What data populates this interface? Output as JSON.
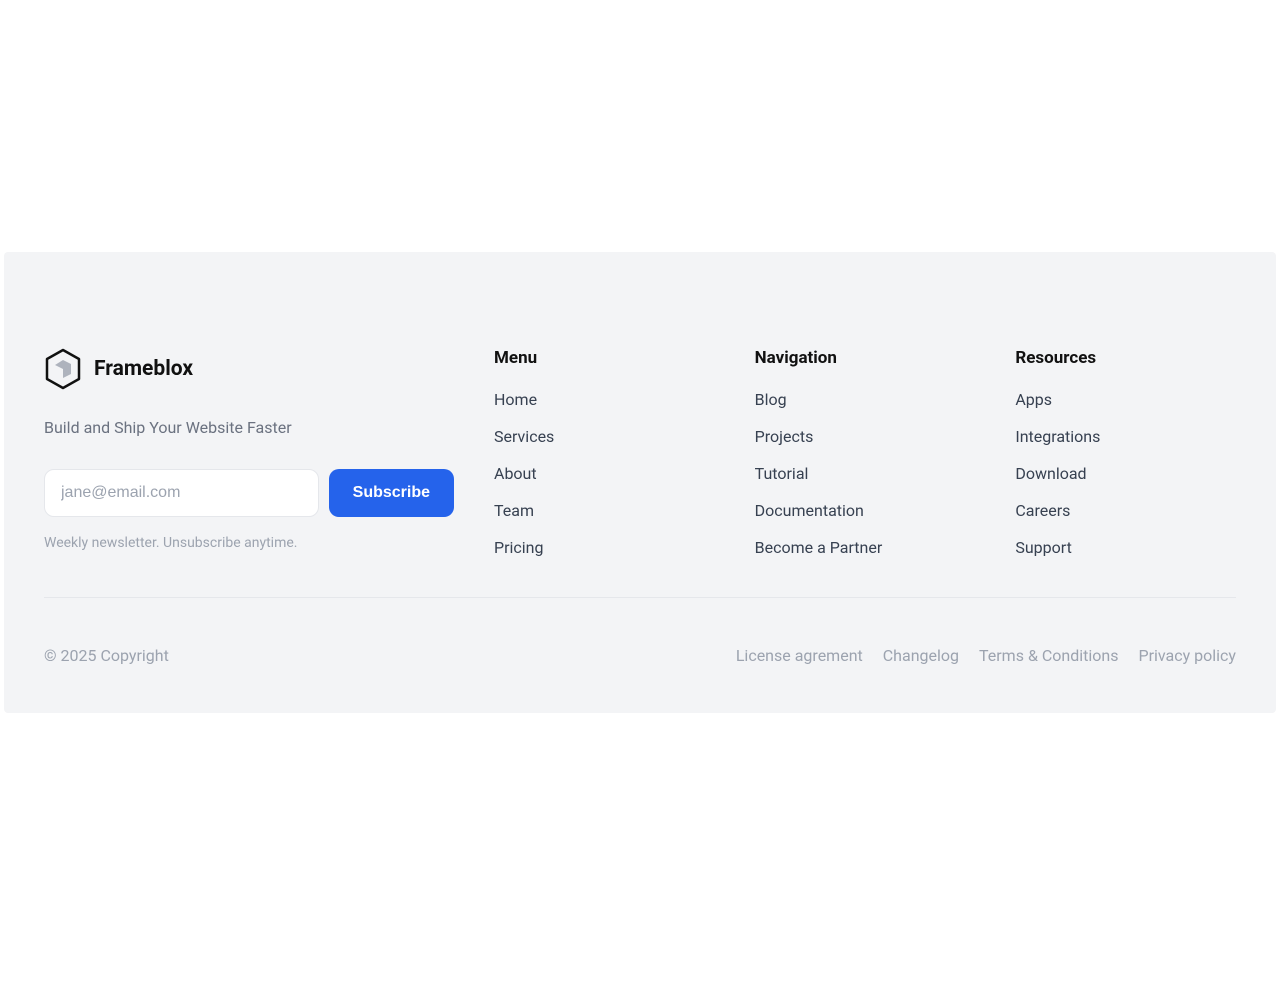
{
  "brand": {
    "name": "Frameblox",
    "tagline": "Build and Ship Your Website Faster"
  },
  "subscribe": {
    "placeholder": "jane@email.com",
    "button": "Subscribe",
    "note": "Weekly newsletter. Unsubscribe anytime."
  },
  "columns": [
    {
      "title": "Menu",
      "links": [
        "Home",
        "Services",
        "About",
        "Team",
        "Pricing"
      ]
    },
    {
      "title": "Navigation",
      "links": [
        "Blog",
        "Projects",
        "Tutorial",
        "Documentation",
        "Become a Partner"
      ]
    },
    {
      "title": "Resources",
      "links": [
        "Apps",
        "Integrations",
        "Download",
        "Careers",
        "Support"
      ]
    }
  ],
  "bottom": {
    "copyright": "© 2025 Copyright",
    "legal": [
      "License agrement",
      "Changelog",
      "Terms & Conditions",
      "Privacy policy"
    ]
  }
}
